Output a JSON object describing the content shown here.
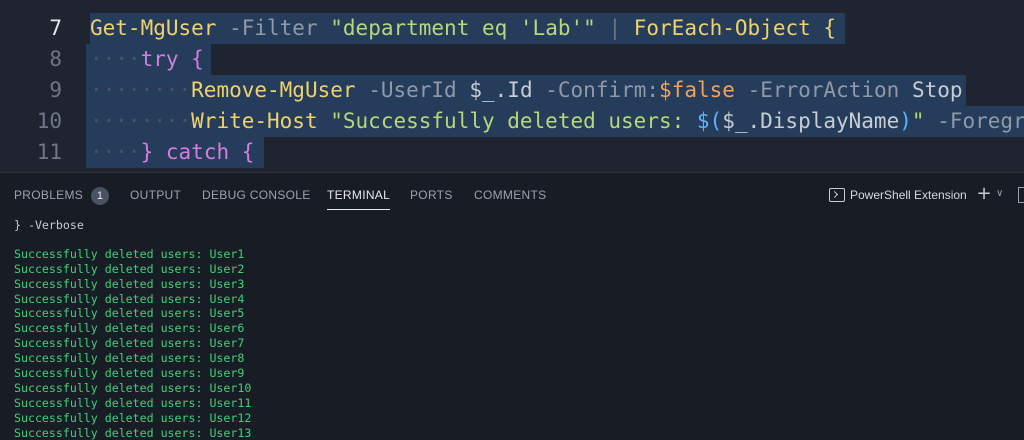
{
  "editor": {
    "line_numbers": [
      "7",
      "8",
      "9",
      "10",
      "11"
    ],
    "active_line": "7",
    "lines": [
      {
        "indent": "",
        "tokens": [
          {
            "t": "Get-MgUser",
            "c": "t-cmd"
          },
          {
            "t": " ",
            "c": "t-plain"
          },
          {
            "t": "-Filter",
            "c": "t-param"
          },
          {
            "t": " ",
            "c": "t-plain"
          },
          {
            "t": "\"department eq 'Lab'\"",
            "c": "t-str"
          },
          {
            "t": " ",
            "c": "t-plain"
          },
          {
            "t": "|",
            "c": "t-pipe"
          },
          {
            "t": " ",
            "c": "t-plain"
          },
          {
            "t": "ForEach-Object",
            "c": "t-cmd"
          },
          {
            "t": " ",
            "c": "t-plain"
          },
          {
            "t": "{",
            "c": "t-brace"
          }
        ]
      },
      {
        "indent": "····",
        "tokens": [
          {
            "t": "try",
            "c": "t-kw"
          },
          {
            "t": " ",
            "c": "t-plain"
          },
          {
            "t": "{",
            "c": "t-kw"
          }
        ]
      },
      {
        "indent": "········",
        "tokens": [
          {
            "t": "Remove-MgUser",
            "c": "t-cmd"
          },
          {
            "t": " ",
            "c": "t-plain"
          },
          {
            "t": "-UserId",
            "c": "t-param"
          },
          {
            "t": " ",
            "c": "t-plain"
          },
          {
            "t": "$_",
            "c": "t-var"
          },
          {
            "t": ".Id",
            "c": "t-plain"
          },
          {
            "t": " ",
            "c": "t-plain"
          },
          {
            "t": "-Confirm:",
            "c": "t-param"
          },
          {
            "t": "$false",
            "c": "t-false"
          },
          {
            "t": " ",
            "c": "t-plain"
          },
          {
            "t": "-ErrorAction",
            "c": "t-param"
          },
          {
            "t": " ",
            "c": "t-plain"
          },
          {
            "t": "Stop",
            "c": "t-plain"
          }
        ]
      },
      {
        "indent": "········",
        "tokens": [
          {
            "t": "Write-Host",
            "c": "t-cmd"
          },
          {
            "t": " ",
            "c": "t-plain"
          },
          {
            "t": "\"Successfully deleted users: ",
            "c": "t-str"
          },
          {
            "t": "$(",
            "c": "t-paren"
          },
          {
            "t": "$_",
            "c": "t-var"
          },
          {
            "t": ".DisplayName",
            "c": "t-plain"
          },
          {
            "t": ")",
            "c": "t-paren"
          },
          {
            "t": "\"",
            "c": "t-str"
          },
          {
            "t": " ",
            "c": "t-plain"
          },
          {
            "t": "-Foregr",
            "c": "t-param"
          }
        ]
      },
      {
        "indent": "····",
        "tokens": [
          {
            "t": "}",
            "c": "t-kw"
          },
          {
            "t": " ",
            "c": "t-plain"
          },
          {
            "t": "catch",
            "c": "t-kw"
          },
          {
            "t": " ",
            "c": "t-plain"
          },
          {
            "t": "{",
            "c": "t-kw"
          }
        ]
      }
    ]
  },
  "panel": {
    "tabs": [
      {
        "label": "PROBLEMS",
        "name": "tab-problems",
        "badge": "1"
      },
      {
        "label": "OUTPUT",
        "name": "tab-output"
      },
      {
        "label": "DEBUG CONSOLE",
        "name": "tab-debug-console"
      },
      {
        "label": "TERMINAL",
        "name": "tab-terminal",
        "active": true
      },
      {
        "label": "PORTS",
        "name": "tab-ports"
      },
      {
        "label": "COMMENTS",
        "name": "tab-comments"
      }
    ],
    "terminal_profile": "PowerShell Extension",
    "icons": {
      "terminal": "terminal-icon",
      "add": "plus-icon",
      "dropdown": "chevron-down-icon",
      "split": "split-terminal-icon"
    }
  },
  "terminal": {
    "command_tail": "} -Verbose",
    "output_lines": [
      "Successfully deleted users: User1",
      "Successfully deleted users: User2",
      "Successfully deleted users: User3",
      "Successfully deleted users: User4",
      "Successfully deleted users: User5",
      "Successfully deleted users: User6",
      "Successfully deleted users: User7",
      "Successfully deleted users: User8",
      "Successfully deleted users: User9",
      "Successfully deleted users: User10",
      "Successfully deleted users: User11",
      "Successfully deleted users: User12",
      "Successfully deleted users: User13"
    ],
    "output_color": "#3fd17a"
  },
  "colors": {
    "editor_bg": "#1f2430",
    "selection": "#253d5a",
    "panel_bg": "#181c24"
  }
}
